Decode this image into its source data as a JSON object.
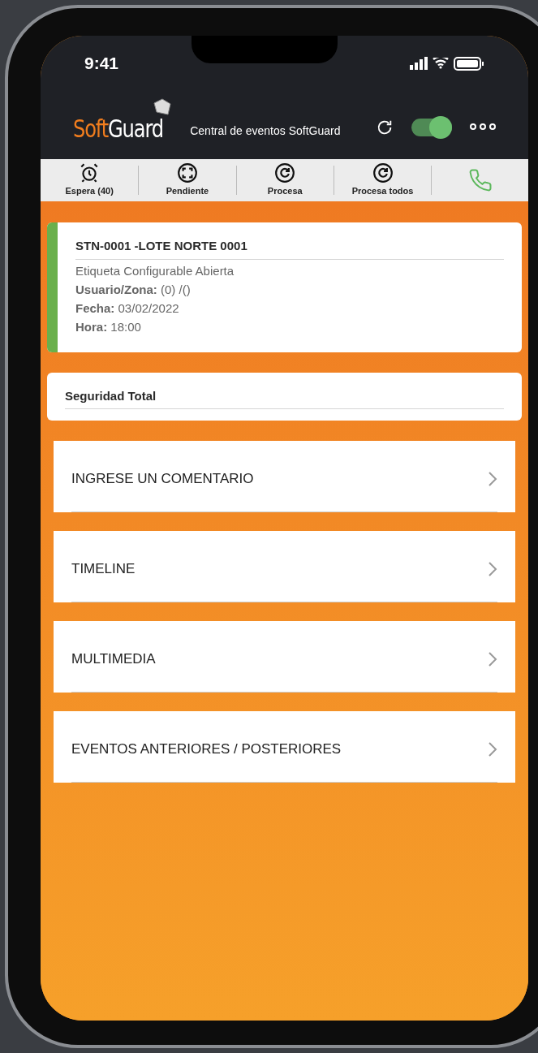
{
  "status_bar": {
    "time": "9:41"
  },
  "header": {
    "logo_parts": [
      "Soft",
      "Guard"
    ],
    "title": "Central de eventos SoftGuard",
    "toggle": {
      "on": true
    }
  },
  "toolbar": [
    {
      "kind": "alarm",
      "label": "Espera (40)"
    },
    {
      "kind": "focus",
      "label": "Pendiente"
    },
    {
      "kind": "process",
      "label": "Procesa"
    },
    {
      "kind": "process",
      "label": "Procesa todos"
    },
    {
      "kind": "phone"
    }
  ],
  "event_card": {
    "color": "#6ab04c",
    "title": "STN-0001 -LOTE NORTE 0001",
    "subtitle": "Etiqueta Configurable Abierta",
    "fields": [
      {
        "label": "Usuario/Zona:",
        "value": "(0) /()"
      },
      {
        "label": "Fecha:",
        "value": "03/02/2022"
      },
      {
        "label": "Hora:",
        "value": "18:00"
      }
    ]
  },
  "group_card": {
    "title": "Seguridad Total"
  },
  "menu": [
    {
      "label": "INGRESE UN COMENTARIO"
    },
    {
      "label": "TIMELINE"
    },
    {
      "label": "MULTIMEDIA"
    },
    {
      "label": "EVENTOS ANTERIORES / POSTERIORES"
    }
  ]
}
